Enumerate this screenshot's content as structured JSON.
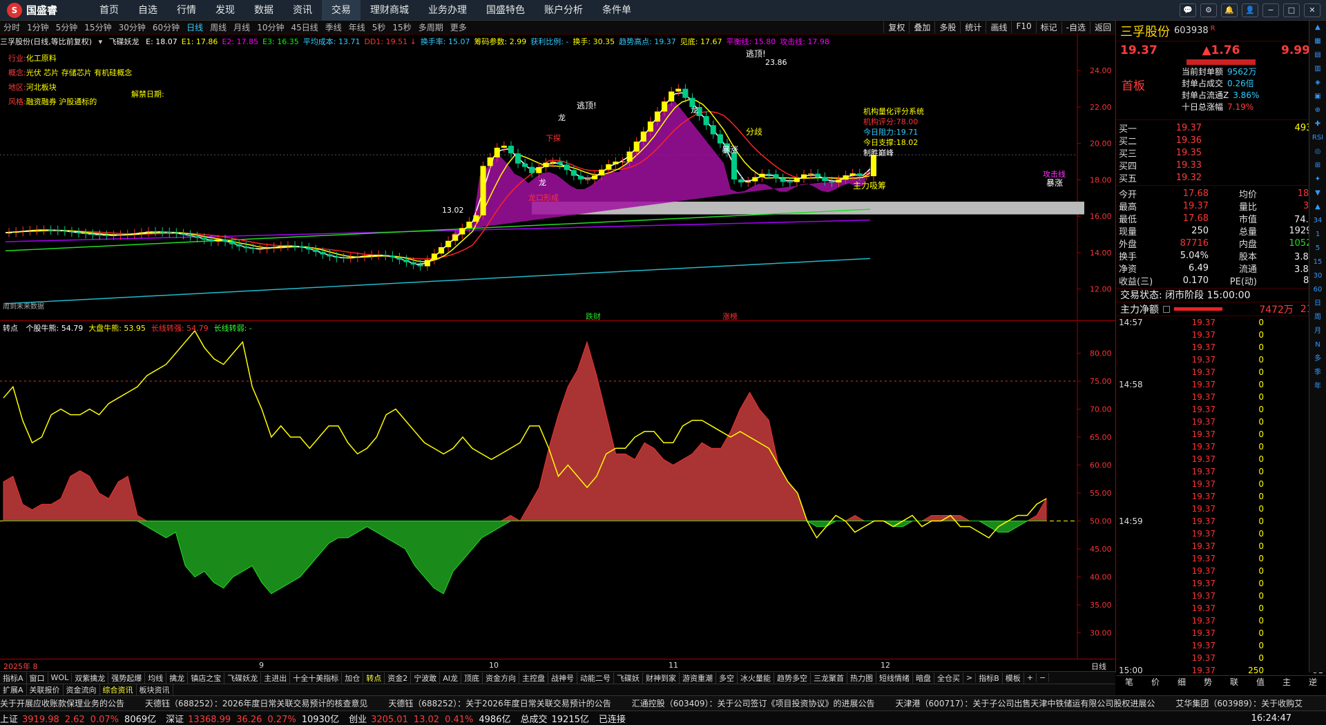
{
  "app": {
    "name": "国盛睿",
    "menu": [
      "首页",
      "自选",
      "行情",
      "发现",
      "数据",
      "资讯",
      "交易",
      "理财商城",
      "业务办理",
      "国盛特色",
      "账户分析",
      "条件单"
    ],
    "active_menu": "交易"
  },
  "window_controls": [
    "💬",
    "⚙",
    "🔔",
    "👤",
    "−",
    "□",
    "✕"
  ],
  "periods": [
    "分时",
    "1分钟",
    "5分钟",
    "15分钟",
    "30分钟",
    "60分钟",
    "日线",
    "周线",
    "月线",
    "10分钟",
    "45日线",
    "季线",
    "年线",
    "5秒",
    "15秒",
    "多周期",
    "更多"
  ],
  "active_period": "日线",
  "chart_tools": [
    "复权",
    "叠加",
    "多股",
    "统计",
    "画线",
    "F10",
    "标记",
    "-自选",
    "返回"
  ],
  "kline": {
    "title": "三孚股份(日线,等比前复权)",
    "indicator": "飞碟妖龙",
    "values": [
      {
        "label": "E: 18.07",
        "color": "#ffffff"
      },
      {
        "label": "E1: 17.86",
        "color": "#ffff00"
      },
      {
        "label": "E2: 17.85",
        "color": "#ff00ff"
      },
      {
        "label": "E3: 16.35",
        "color": "#00ff00"
      },
      {
        "label": "平均成本: 13.71",
        "color": "#33ccff"
      },
      {
        "label": "DD1: 19.51 ↓",
        "color": "#ff3333"
      },
      {
        "label": "换手率: 15.07",
        "color": "#33ccff"
      },
      {
        "label": "筹码参数: 2.99",
        "color": "#ffff00"
      },
      {
        "label": "获利比例: -",
        "color": "#33ccff"
      },
      {
        "label": "换手: 30.35",
        "color": "#ffff00"
      },
      {
        "label": "趋势高点: 19.37",
        "color": "#33ccff"
      },
      {
        "label": "见底: 17.67",
        "color": "#ffff00"
      },
      {
        "label": "平衡线: 15.80",
        "color": "#ff00ff"
      },
      {
        "label": "攻击线: 17.98",
        "color": "#ff00ff"
      }
    ],
    "info_lines": [
      {
        "k": "行业:",
        "v": "化工原料"
      },
      {
        "k": "概念:",
        "v": "光伏 芯片 存储芯片 有机硅概念"
      },
      {
        "k": "地区:",
        "v": "河北板块"
      },
      {
        "k": "风格:",
        "v": "融资融券 沪股通标的"
      }
    ],
    "unlock_label": "解禁日期:",
    "yticks": [
      "24.00",
      "22.00",
      "20.00",
      "18.00",
      "16.00",
      "14.00",
      "12.00"
    ],
    "yrange": [
      11,
      25.6
    ],
    "annotations": {
      "peak": "23.86",
      "low": "13.02",
      "peak_label": "逃顶!",
      "peak_label2": "逃顶!",
      "dragon": "龙",
      "split": "分歧",
      "surge": "暴涨",
      "surge2": "暴涨",
      "main": "主力吸筹",
      "dragon_open": "龙口形成",
      "attack": "攻击线",
      "sell": "下探",
      "future": "周到未来数据",
      "bottom_fall": "跌财",
      "bottom_rise": "涨榜"
    },
    "score": {
      "title": "机构量化评分系统",
      "lines": [
        {
          "k": "机构评分:",
          "v": "78.00",
          "color": "#ff3333"
        },
        {
          "k": "今日阻力:",
          "v": "19.71",
          "color": "#33ccff"
        },
        {
          "k": "今日支撑:",
          "v": "18.02",
          "color": "#ffff00"
        },
        {
          "k": "制胜巅峰",
          "v": "",
          "color": "#ffffff"
        }
      ]
    }
  },
  "oscillator": {
    "title": "转点",
    "values": [
      {
        "label": "个股牛熊: 54.79",
        "color": "#ffffff"
      },
      {
        "label": "大盘牛熊: 53.95",
        "color": "#ffff00"
      },
      {
        "label": "长线转强: 54.79",
        "color": "#ff3333"
      },
      {
        "label": "长线转弱: -",
        "color": "#33ff33"
      }
    ],
    "yticks": [
      "80.00",
      "75.00",
      "70.00",
      "65.00",
      "60.00",
      "55.00",
      "50.00",
      "45.00",
      "40.00",
      "35.00",
      "30.00"
    ],
    "yrange": [
      26,
      85
    ],
    "stock": [
      57,
      58,
      53,
      52,
      53,
      53,
      54,
      58,
      59,
      58,
      55,
      54,
      57,
      58,
      51,
      49,
      48,
      47,
      48,
      42,
      40,
      41,
      39,
      38,
      40,
      41,
      42,
      39,
      37,
      38,
      39,
      40,
      42,
      44,
      46,
      47,
      47,
      48,
      49,
      48,
      47,
      46,
      45,
      42,
      40,
      38,
      37,
      41,
      43,
      45,
      47,
      48,
      49,
      51,
      50,
      53,
      56,
      63,
      69,
      74,
      77,
      82,
      76,
      69,
      62,
      62,
      61,
      64,
      63,
      61,
      60,
      61,
      62,
      64,
      63,
      63,
      66,
      70,
      73,
      70,
      68,
      60,
      57,
      55,
      50,
      49,
      49,
      50,
      50,
      51,
      50,
      50,
      50,
      49,
      49,
      50,
      50,
      51,
      51,
      51,
      51,
      50,
      50,
      49,
      48,
      48,
      49,
      50,
      51,
      54
    ],
    "market": [
      72,
      74,
      68,
      64,
      65,
      69,
      70,
      69,
      69,
      70,
      69,
      71,
      72,
      73,
      74,
      76,
      77,
      78,
      80,
      82,
      84,
      81,
      79,
      78,
      80,
      82,
      74,
      70,
      65,
      67,
      65,
      65,
      63,
      65,
      67,
      67,
      64,
      62,
      63,
      65,
      69,
      70,
      68,
      66,
      64,
      63,
      62,
      63,
      65,
      63,
      62,
      61,
      62,
      63,
      64,
      67,
      67,
      63,
      58,
      60,
      58,
      56,
      58,
      62,
      63,
      63,
      65,
      66,
      66,
      64,
      64,
      67,
      68,
      68,
      67,
      66,
      65,
      66,
      65,
      64,
      63,
      60,
      57,
      55,
      50,
      47,
      49,
      51,
      50,
      48,
      49,
      50,
      50,
      49,
      50,
      51,
      49,
      50,
      50,
      51,
      49,
      49,
      48,
      47,
      49,
      50,
      51,
      51,
      53,
      54
    ]
  },
  "xaxis": {
    "labels": [
      "2025年 8",
      "9",
      "10",
      "11",
      "12"
    ],
    "right": "日线"
  },
  "indicator_tabs": [
    "指标A",
    "窗口",
    "WOL",
    "双紫擒龙",
    "强势起爆",
    "均线",
    "擒龙",
    "镇店之宝",
    "飞碟妖龙",
    "主进出",
    "十全十美指标",
    "加仓",
    "转点",
    "资金2",
    "宁波敢",
    "AI龙",
    "顶底",
    "资金方向",
    "主控盘",
    "战神号",
    "动能二号",
    "飞碟妖",
    "财神到家",
    "游资重潮",
    "多空",
    "冰火量能",
    "趋势多空",
    "三龙聚首",
    "热力图",
    "短线情绪",
    "暗盘",
    "全仓买",
    ">",
    "指标B",
    "模板",
    "+",
    "−"
  ],
  "active_indicator_tab": "转点",
  "sub_tabs": [
    "扩展A",
    "关联报价",
    "资金流向",
    "综合资讯",
    "板块资讯"
  ],
  "active_sub_tab": "综合资讯",
  "quote": {
    "name": "三孚股份",
    "code": "603938",
    "r": "R",
    "price": "19.37",
    "change": "▲1.76",
    "pct": "9.99%",
    "board": "首板",
    "seal": [
      {
        "k": "当前封单额",
        "v": "9562万"
      },
      {
        "k": "封单占成交",
        "v": "0.26倍"
      },
      {
        "k": "封单占流通Z",
        "v": "3.86%"
      },
      {
        "k": "十日总涨幅",
        "v": "7.19%"
      }
    ],
    "bids": [
      {
        "k": "买一",
        "p": "19.37",
        "v": "49364"
      },
      {
        "k": "买二",
        "p": "19.36",
        "v": "34"
      },
      {
        "k": "买三",
        "p": "19.35",
        "v": "35"
      },
      {
        "k": "买四",
        "p": "19.33",
        "v": "4"
      },
      {
        "k": "买五",
        "p": "19.32",
        "v": "16"
      }
    ],
    "stats": [
      {
        "a": "今开",
        "b": "17.68",
        "c": "均价",
        "d": "18.71"
      },
      {
        "a": "最高",
        "b": "19.37",
        "c": "量比",
        "d": "3.57"
      },
      {
        "a": "最低",
        "b": "17.68",
        "c": "市值",
        "d": "74.1亿"
      },
      {
        "a": "现量",
        "b": "250",
        "c": "总量",
        "d": "192949"
      },
      {
        "a": "外盘",
        "b": "87716",
        "c": "内盘",
        "d": "105233"
      },
      {
        "a": "换手",
        "b": "5.04%",
        "c": "股本",
        "d": "3.83亿"
      },
      {
        "a": "净资",
        "b": "6.49",
        "c": "流通",
        "d": "3.83亿"
      },
      {
        "a": "收益(三)",
        "b": "0.170",
        "c": "PE(动)",
        "d": "86.7"
      }
    ],
    "state": "交易状态: 闭市阶段 15:00:00",
    "netflow_label": "主力净额",
    "netflow": "7472万",
    "netflow_pct": "21%",
    "ticks": [
      {
        "t": "14:57",
        "p": "19.37",
        "v": "0"
      },
      {
        "t": "",
        "p": "19.37",
        "v": "0"
      },
      {
        "t": "",
        "p": "19.37",
        "v": "0"
      },
      {
        "t": "",
        "p": "19.37",
        "v": "0"
      },
      {
        "t": "",
        "p": "19.37",
        "v": "0"
      },
      {
        "t": "14:58",
        "p": "19.37",
        "v": "0"
      },
      {
        "t": "",
        "p": "19.37",
        "v": "0"
      },
      {
        "t": "",
        "p": "19.37",
        "v": "0"
      },
      {
        "t": "",
        "p": "19.37",
        "v": "0"
      },
      {
        "t": "",
        "p": "19.37",
        "v": "0"
      },
      {
        "t": "",
        "p": "19.37",
        "v": "0"
      },
      {
        "t": "",
        "p": "19.37",
        "v": "0"
      },
      {
        "t": "",
        "p": "19.37",
        "v": "0"
      },
      {
        "t": "",
        "p": "19.37",
        "v": "0"
      },
      {
        "t": "",
        "p": "19.37",
        "v": "0"
      },
      {
        "t": "",
        "p": "19.37",
        "v": "0"
      },
      {
        "t": "14:59",
        "p": "19.37",
        "v": "0"
      },
      {
        "t": "",
        "p": "19.37",
        "v": "0"
      },
      {
        "t": "",
        "p": "19.37",
        "v": "0"
      },
      {
        "t": "",
        "p": "19.37",
        "v": "0"
      },
      {
        "t": "",
        "p": "19.37",
        "v": "0"
      },
      {
        "t": "",
        "p": "19.37",
        "v": "0"
      },
      {
        "t": "",
        "p": "19.37",
        "v": "0"
      },
      {
        "t": "",
        "p": "19.37",
        "v": "0"
      },
      {
        "t": "",
        "p": "19.37",
        "v": "0"
      },
      {
        "t": "",
        "p": "19.37",
        "v": "0"
      },
      {
        "t": "",
        "p": "19.37",
        "v": "0"
      },
      {
        "t": "",
        "p": "19.37",
        "v": "0"
      },
      {
        "t": "15:00",
        "p": "19.37",
        "v": "250",
        "x": "31"
      }
    ],
    "bottom_tabs": [
      "笔",
      "价",
      "细",
      "势",
      "联",
      "值",
      "主",
      "逆"
    ]
  },
  "news": [
    "关于开展应收账款保理业务的公告",
    "天德钰（688252）：2026年度日常关联交易预计的核查意见",
    "天德钰（688252）：关于2026年度日常关联交易预计的公告",
    "汇通控股（603409）：关于公司签订《项目投资协议》的进展公告",
    "天津港（600717）：关于子公司出售天津中铁储运有限公司股权进展公",
    "艾华集团（603989）：关于收购艾"
  ],
  "news_tag": "图文F10 侧边栏 «",
  "status": {
    "items": [
      {
        "name": "上证",
        "v": "3919.98",
        "c": "2.62",
        "p": "0.07%",
        "amt": "8069亿",
        "color": "#ff3c3c"
      },
      {
        "name": "深证",
        "v": "13368.99",
        "c": "36.26",
        "p": "0.27%",
        "amt": "10930亿",
        "color": "#ff3c3c"
      },
      {
        "name": "创业",
        "v": "3205.01",
        "c": "13.02",
        "p": "0.41%",
        "amt": "4986亿",
        "color": "#ff3c3c"
      }
    ],
    "total_label": "总成交",
    "total": "19215亿",
    "conn": "已连接",
    "time": "16:24:47"
  },
  "side_icons": [
    "▲",
    "▦",
    "▤",
    "▥",
    "◈",
    "▣",
    "⊕",
    "✚",
    "RSI",
    "◎",
    "⊞",
    "✦",
    "▼",
    "▲",
    "34",
    "1",
    "5",
    "15",
    "30",
    "60",
    "日",
    "周",
    "月",
    "N",
    "多",
    "季",
    "年"
  ]
}
